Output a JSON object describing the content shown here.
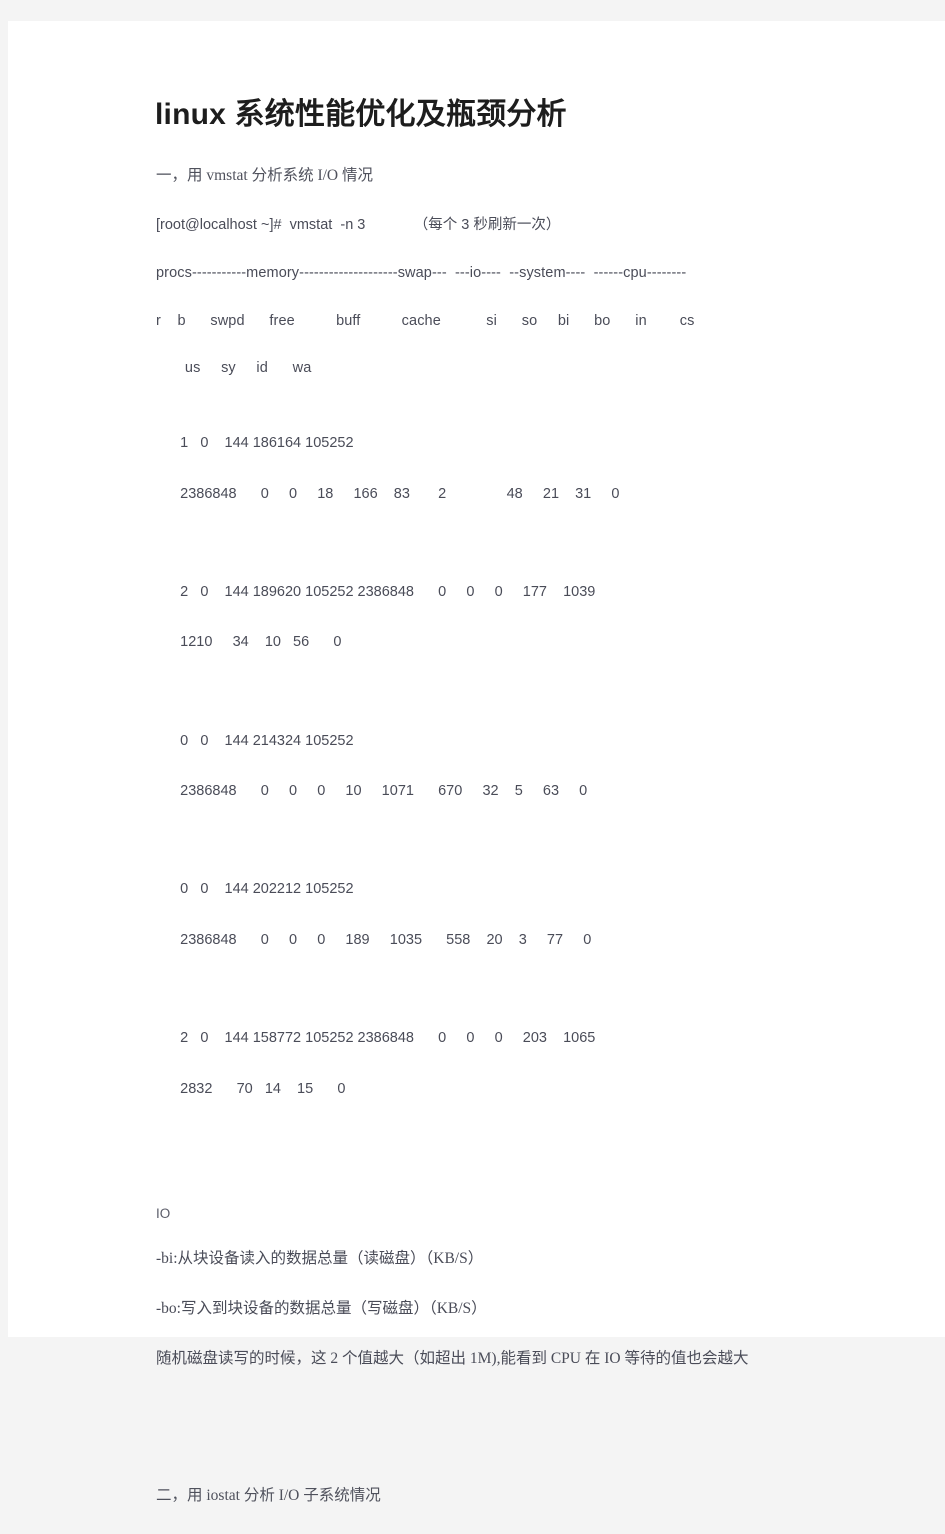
{
  "document": {
    "title": "linux 系统性能优化及瓶颈分析",
    "section_one": {
      "heading": "一，用 vmstat 分析系统 I/O 情况",
      "command_line": "[root@localhost ~]#  vmstat  -n 3            （每个 3 秒刷新一次）",
      "table_header_groups": "procs-----------memory--------------------swap---  ---io----  --system----  ------cpu--------",
      "table_header_cols_line1": "r    b      swpd      free          buff          cache           si      so     bi      bo      in        cs",
      "table_header_cols_line2": "       us     sy     id      wa",
      "samples": [
        {
          "line1": "1   0    144 186164 105252",
          "line2": "2386848      0     0     18     166    83       2               48     21    31     0"
        },
        {
          "line1": "2   0    144 189620 105252 2386848      0     0     0     177    1039",
          "line2": "1210     34    10   56      0"
        },
        {
          "line1": "0   0    144 214324 105252",
          "line2": "2386848      0     0     0     10     1071      670     32    5     63     0"
        },
        {
          "line1": "0   0    144 202212 105252",
          "line2": "2386848      0     0     0     189     1035      558    20    3     77     0"
        },
        {
          "line1": "2   0    144 158772 105252 2386848      0     0     0     203    1065",
          "line2": "2832      70   14    15      0"
        }
      ],
      "io_label": "IO",
      "io_bi": "-bi:从块设备读入的数据总量（读磁盘）（KB/S）",
      "io_bo": "-bo:写入到块设备的数据总量（写磁盘）（KB/S）",
      "io_note": "随机磁盘读写的时候，这 2 个值越大（如超出 1M),能看到 CPU 在 IO 等待的值也会越大"
    },
    "section_two": {
      "heading": "二，用 iostat 分析 I/O 子系统情况"
    }
  },
  "colors": {
    "page_background": "#f4f4f4",
    "paper": "#ffffff",
    "title_text": "#1d1d1d",
    "body_text": "#4a4c58"
  }
}
